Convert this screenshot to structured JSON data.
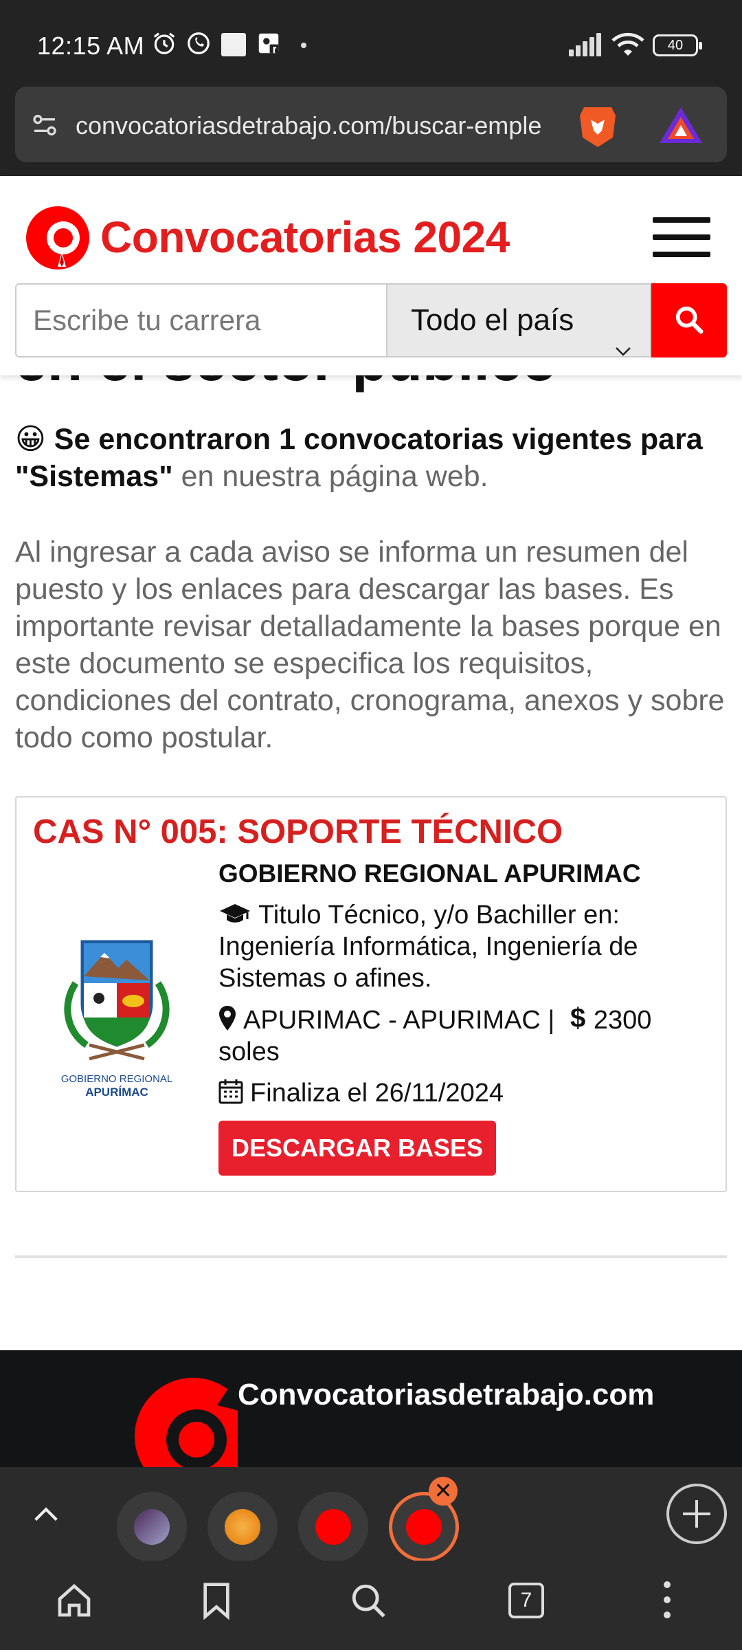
{
  "status_bar": {
    "time": "12:15 AM",
    "battery": "40"
  },
  "browser": {
    "url": "convocatoriasdetrabajo.com/buscar-emple"
  },
  "header": {
    "brand": "Convocatorias 2024",
    "search": {
      "placeholder": "Escribe tu carrera",
      "country_selected": "Todo el país"
    }
  },
  "content": {
    "cut_heading": "en el sector público",
    "found_emoji": "😀",
    "found_bold": "Se encontraron 1 convocatorias vigentes para \"Sistemas\"",
    "found_rest": " en nuestra página web.",
    "paragraph": "Al ingresar a cada aviso se informa un resumen del puesto y los enlaces para descargar las bases. Es importante revisar detalladamente la bases porque en este documento se especifica los requisitos, condiciones del contrato, cronograma, anexos y sobre todo como postular.",
    "job": {
      "title": "CAS N° 005: SOPORTE TÉCNICO",
      "entity": "GOBIERNO REGIONAL APURIMAC",
      "emblem_caption_1": "GOBIERNO REGIONAL",
      "emblem_caption_2": "APURÍMAC",
      "requirement": "Titulo Técnico, y/o Bachiller en: Ingeniería Informática, Ingeniería de Sistemas o afines.",
      "location": "APURIMAC - APURIMAC |",
      "salary": "2300 soles",
      "deadline": "Finaliza el 26/11/2024",
      "download_label": "DESCARGAR BASES"
    }
  },
  "footer": {
    "site_name": "Convocatoriasdetrabajo.com"
  },
  "tabs": {
    "count": "7"
  },
  "colors": {
    "brand_red": "#e41e1e",
    "title_red": "#d62020",
    "button_red": "#e8202e",
    "active_tab": "#f26f3a"
  }
}
